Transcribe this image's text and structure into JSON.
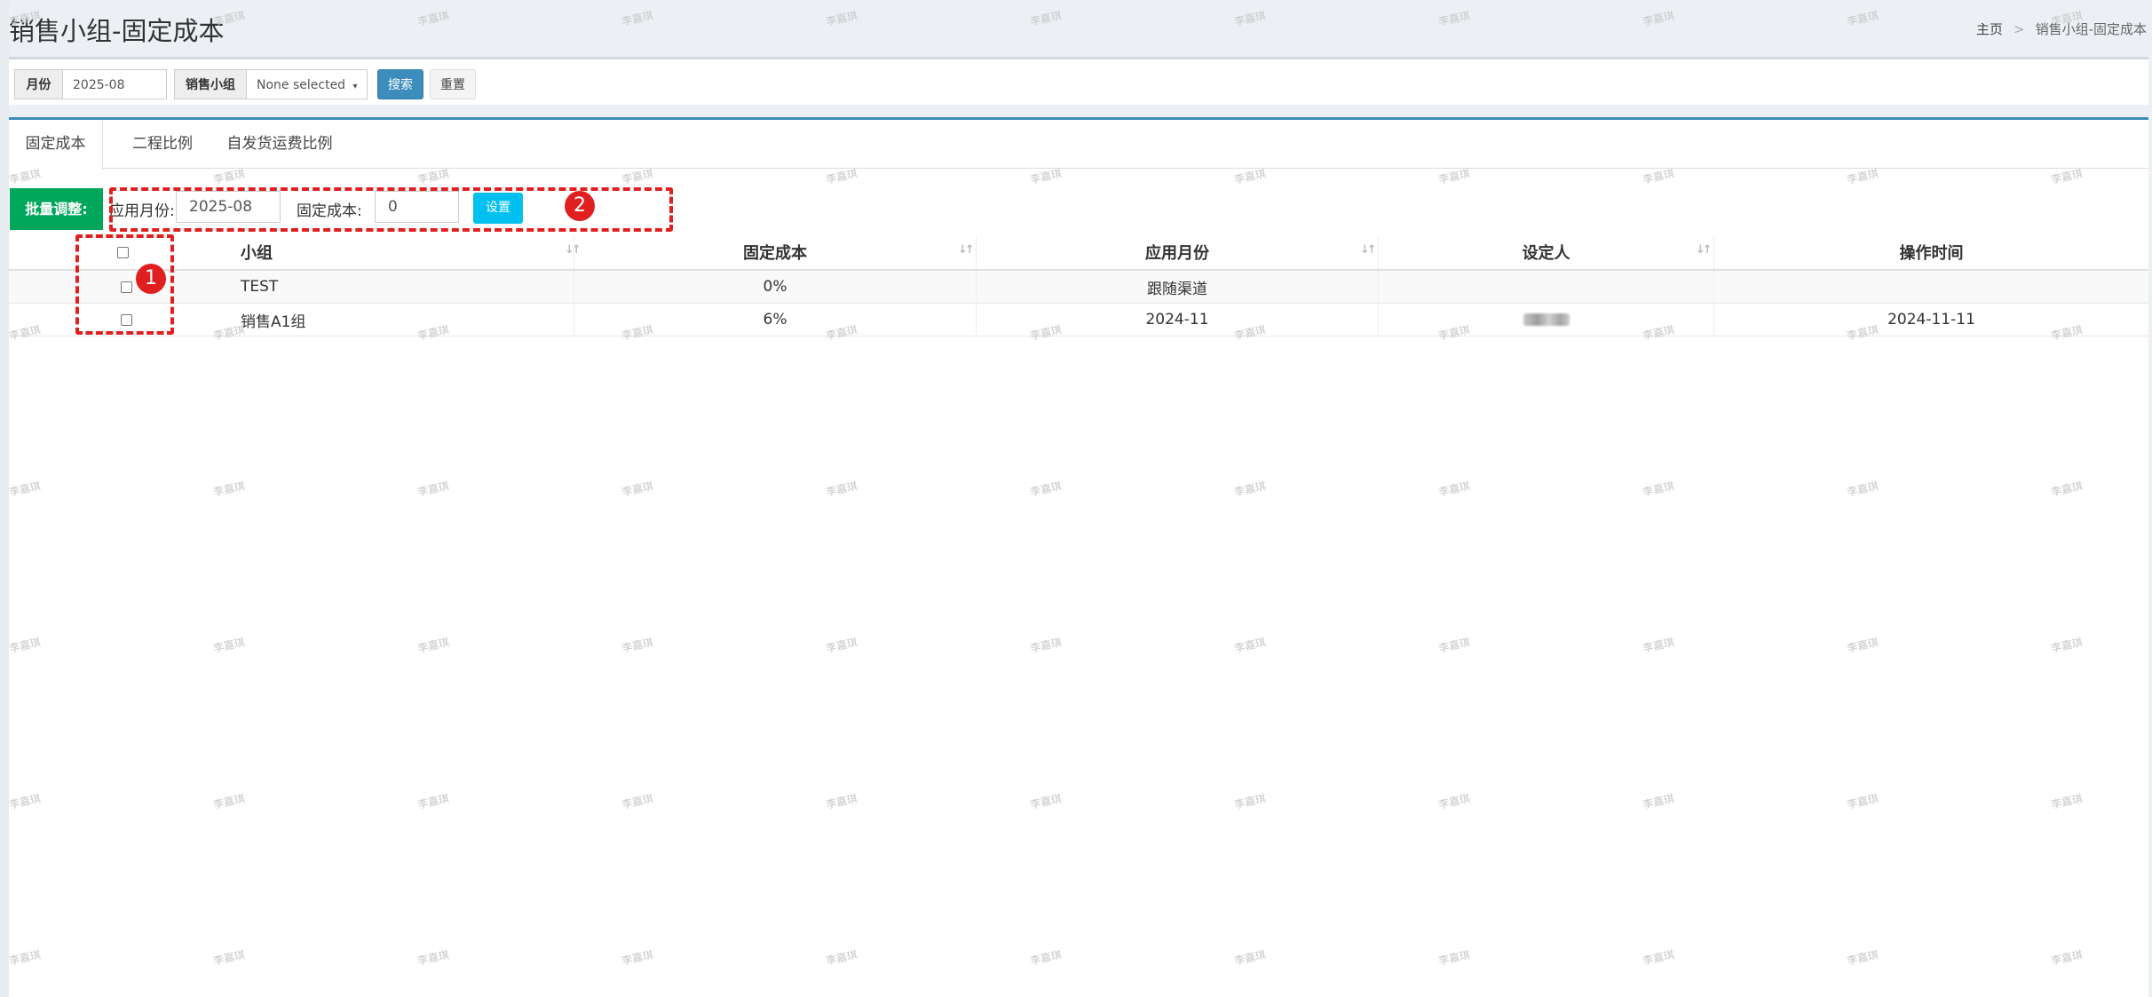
{
  "header": {
    "title": "销售小组-固定成本",
    "breadcrumb": {
      "home": "主页",
      "separator": ">",
      "current": "销售小组-固定成本"
    }
  },
  "filters": {
    "month_label": "月份",
    "month_value": "2025-08",
    "group_label": "销售小组",
    "group_value": "None selected",
    "search_label": "搜索",
    "reset_label": "重置"
  },
  "tabs": [
    {
      "label": "固定成本",
      "active": true
    },
    {
      "label": "二程比例",
      "active": false
    },
    {
      "label": "自发货运费比例",
      "active": false
    }
  ],
  "batch": {
    "title": "批量调整:",
    "month_label": "应用月份:",
    "month_value": "2025-08",
    "cost_label": "固定成本:",
    "cost_value": "0",
    "set_label": "设置"
  },
  "table": {
    "columns": [
      "小组",
      "固定成本",
      "应用月份",
      "设定人",
      "操作时间"
    ],
    "rows": [
      {
        "group": "TEST",
        "cost": "0%",
        "month": "跟随渠道",
        "setter": "",
        "time": ""
      },
      {
        "group": "销售A1组",
        "cost": "6%",
        "month": "2024-11",
        "setter": "",
        "time": "2024-11-11"
      }
    ]
  },
  "annotations": {
    "badge1": "1",
    "badge2": "2"
  },
  "watermark": "李嘉琪",
  "colors": {
    "primary": "#3c8dbc",
    "success": "#00a65a",
    "info": "#00c0ef",
    "annotation": "#e02020"
  }
}
